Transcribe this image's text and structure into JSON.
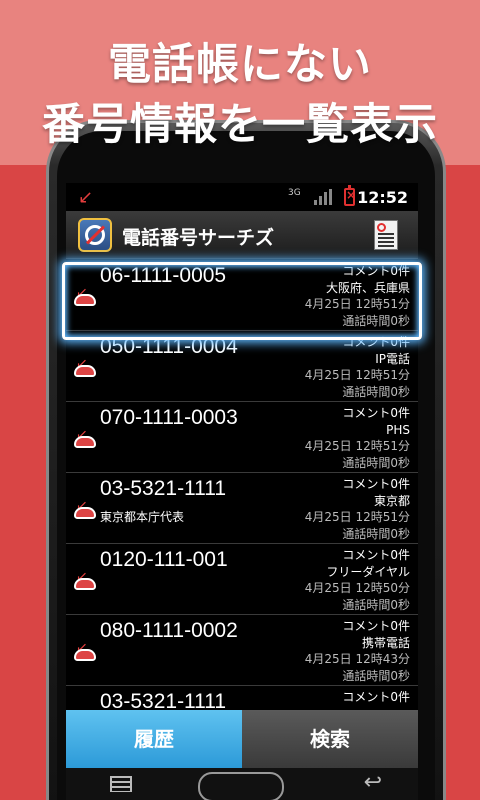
{
  "headline": {
    "line1": "電話帳にない",
    "line2": "番号情報を一覧表示"
  },
  "statusbar": {
    "network": "3G",
    "time": "12:52"
  },
  "app": {
    "title": "電話番号サーチズ"
  },
  "calls": [
    {
      "number": "06-1111-0005",
      "location": "",
      "comment": "コメント0件",
      "region": "大阪府、兵庫県",
      "datetime": "4月25日 12時51分",
      "duration": "通話時間0秒",
      "selected": true
    },
    {
      "number": "050-1111-0004",
      "location": "",
      "comment": "コメント0件",
      "region": "IP電話",
      "datetime": "4月25日 12時51分",
      "duration": "通話時間0秒",
      "selected": false
    },
    {
      "number": "070-1111-0003",
      "location": "",
      "comment": "コメント0件",
      "region": "PHS",
      "datetime": "4月25日 12時51分",
      "duration": "通話時間0秒",
      "selected": false
    },
    {
      "number": "03-5321-1111",
      "location": "東京都本庁代表",
      "comment": "コメント0件",
      "region": "東京都",
      "datetime": "4月25日 12時51分",
      "duration": "通話時間0秒",
      "selected": false
    },
    {
      "number": "0120-111-001",
      "location": "",
      "comment": "コメント0件",
      "region": "フリーダイヤル",
      "datetime": "4月25日 12時50分",
      "duration": "通話時間0秒",
      "selected": false
    },
    {
      "number": "080-1111-0002",
      "location": "",
      "comment": "コメント0件",
      "region": "携帯電話",
      "datetime": "4月25日 12時43分",
      "duration": "通話時間0秒",
      "selected": false
    },
    {
      "number": "03-5321-1111",
      "location": "",
      "comment": "コメント0件",
      "region": "",
      "datetime": "",
      "duration": "",
      "selected": false
    }
  ],
  "tabs": {
    "history": "履歴",
    "search": "検索"
  },
  "colors": {
    "accent": "#2c9ad8",
    "missed_call": "#e23d3d",
    "banner": "#d94545"
  }
}
